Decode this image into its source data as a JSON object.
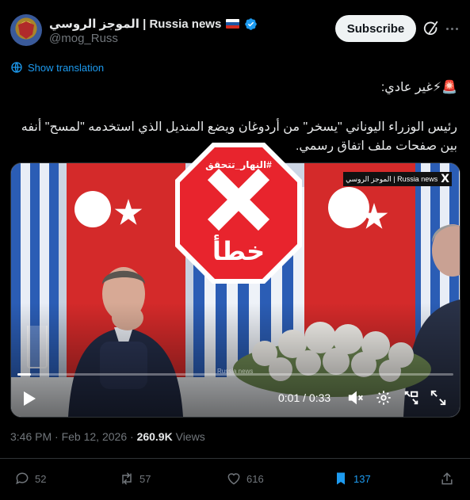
{
  "author": {
    "display_name": "الموجز الروسي | Russia news",
    "handle": "@mog_Russ",
    "flag_colors": [
      "#ffffff",
      "#1c57a5",
      "#d52b1e"
    ]
  },
  "header": {
    "subscribe_label": "Subscribe",
    "grok_icon": "grok-icon",
    "more_icon": "more-icon"
  },
  "translation": {
    "label": "Show translation"
  },
  "post": {
    "line1": "🚨⚡غير عادي:",
    "body": "رئيس الوزراء اليوناني \"يسخر\" من أردوغان ويضع المنديل الذي استخدمه \"لمسح\" أنفه بين صفحات ملف اتفاق رسمي."
  },
  "video": {
    "watermark_text": "الموجز الروسي | Russia news",
    "watermark_logo": "X",
    "progress_watermark": "Russia news",
    "time": "0:01 / 0:33",
    "progress": 0.03
  },
  "stamp": {
    "hashtag": "#النهار_تتحقق",
    "verdict": "خطأ",
    "color": "#e8242d"
  },
  "meta": {
    "time": "3:46 PM",
    "date": "Feb 12, 2026",
    "views_count": "260.9K",
    "views_label": "Views"
  },
  "actions": {
    "replies": "52",
    "reposts": "57",
    "likes": "616",
    "bookmarks": "137"
  },
  "colors": {
    "accent": "#1d9bf0",
    "muted": "#71767b",
    "background": "#000000"
  }
}
